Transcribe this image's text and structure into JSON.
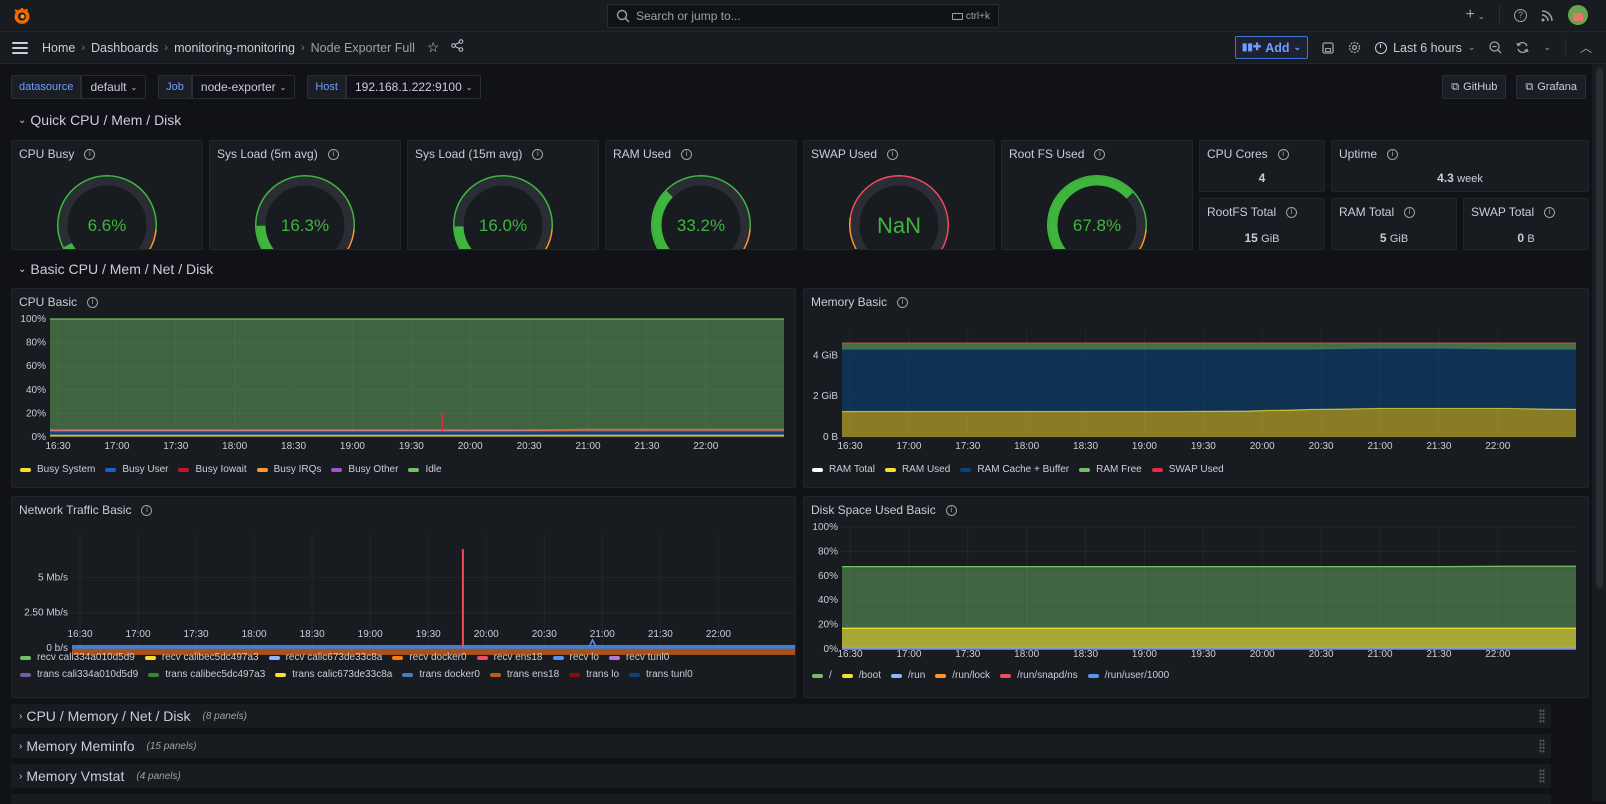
{
  "topbar": {
    "search_placeholder": "Search or jump to...",
    "search_shortcut": "ctrl+k",
    "icons": [
      "grafana-logo-icon",
      "plus-icon",
      "help-icon",
      "news-icon",
      "user-avatar"
    ]
  },
  "breadcrumb": {
    "items": [
      "Home",
      "Dashboards",
      "monitoring-monitoring",
      "Node Exporter Full"
    ]
  },
  "toolbar": {
    "add_label": "Add",
    "time_range": "Last 6 hours"
  },
  "variables": [
    {
      "label": "datasource",
      "value": "default"
    },
    {
      "label": "Job",
      "value": "node-exporter"
    },
    {
      "label": "Host",
      "value": "192.168.1.222:9100"
    }
  ],
  "links": [
    {
      "label": "GitHub"
    },
    {
      "label": "Grafana"
    }
  ],
  "rows": {
    "quick": "Quick CPU / Mem / Disk",
    "basic": "Basic CPU / Mem / Net / Disk",
    "collapsed": [
      {
        "title": "CPU / Memory / Net / Disk",
        "count": "(8 panels)"
      },
      {
        "title": "Memory Meminfo",
        "count": "(15 panels)"
      },
      {
        "title": "Memory Vmstat",
        "count": "(4 panels)"
      }
    ]
  },
  "gauges": [
    {
      "title": "CPU Busy",
      "value_text": "6.6%",
      "value": 6.6
    },
    {
      "title": "Sys Load (5m avg)",
      "value_text": "16.3%",
      "value": 16.3
    },
    {
      "title": "Sys Load (15m avg)",
      "value_text": "16.0%",
      "value": 16.0
    },
    {
      "title": "RAM Used",
      "value_text": "33.2%",
      "value": 33.2
    },
    {
      "title": "SWAP Used",
      "value_text": "NaN",
      "value": null
    },
    {
      "title": "Root FS Used",
      "value_text": "67.8%",
      "value": 67.8
    }
  ],
  "stats": [
    {
      "title": "CPU Cores",
      "value": "4",
      "unit": ""
    },
    {
      "title": "Uptime",
      "value": "4.3",
      "unit": "week"
    },
    {
      "title": "RootFS Total",
      "value": "15",
      "unit": "GiB"
    },
    {
      "title": "RAM Total",
      "value": "5",
      "unit": "GiB"
    },
    {
      "title": "SWAP Total",
      "value": "0",
      "unit": "B"
    }
  ],
  "colors": {
    "green": "#3eb63e",
    "orange": "#ff9830",
    "red": "#f2495c",
    "accent": "#6e9fff"
  },
  "chart_data": [
    {
      "type": "area",
      "title": "CPU Basic",
      "x": [
        "16:30",
        "17:00",
        "17:30",
        "18:00",
        "18:30",
        "19:00",
        "19:30",
        "20:00",
        "20:30",
        "21:00",
        "21:30",
        "22:00"
      ],
      "yticks": [
        "0%",
        "20%",
        "40%",
        "60%",
        "80%",
        "100%"
      ],
      "ylim": [
        0,
        100
      ],
      "stacked": true,
      "series": [
        {
          "name": "Busy System",
          "color": "#fade2a",
          "values": [
            1.5,
            1.5,
            1.5,
            1.5,
            1.5,
            1.5,
            1.5,
            1.5,
            1.5,
            1.5,
            1.5,
            1.5
          ]
        },
        {
          "name": "Busy User",
          "color": "#1f60c4",
          "values": [
            3,
            3,
            3,
            3,
            3,
            3,
            3,
            3,
            3.5,
            3.5,
            3.5,
            3.5
          ]
        },
        {
          "name": "Busy Iowait",
          "color": "#c4162a",
          "values": [
            1,
            1,
            1,
            1,
            1,
            1,
            1,
            1,
            1,
            1,
            1,
            1
          ]
        },
        {
          "name": "Busy IRQs",
          "color": "#ff9830",
          "values": [
            0,
            0,
            0,
            0,
            0,
            0,
            0,
            0,
            0,
            0,
            0,
            0
          ]
        },
        {
          "name": "Busy Other",
          "color": "#a352cc",
          "values": [
            0.5,
            0.5,
            0.5,
            0.5,
            0.5,
            0.5,
            0.5,
            0.5,
            0.5,
            0.5,
            0.5,
            0.5
          ]
        },
        {
          "name": "Idle",
          "color": "#73bf69",
          "values": [
            94,
            94,
            94,
            94,
            94,
            94,
            94,
            94,
            93.5,
            93.5,
            93.5,
            93.5
          ]
        }
      ],
      "annotations": [
        "spike ~20% near 19:30"
      ]
    },
    {
      "type": "area",
      "title": "Memory Basic",
      "x": [
        "16:30",
        "17:00",
        "17:30",
        "18:00",
        "18:30",
        "19:00",
        "19:30",
        "20:00",
        "20:30",
        "21:00",
        "21:30",
        "22:00"
      ],
      "yticks": [
        "0 B",
        "2 GiB",
        "4 GiB"
      ],
      "ylim": [
        0,
        5.2
      ],
      "unit": "GiB",
      "series": [
        {
          "name": "RAM Total",
          "color": "#ffffff",
          "values": [
            4.6,
            4.6,
            4.6,
            4.6,
            4.6,
            4.6,
            4.6,
            4.6,
            4.6,
            4.6,
            4.6,
            4.6
          ]
        },
        {
          "name": "RAM Used",
          "color": "#fade2a",
          "values": [
            1.25,
            1.25,
            1.25,
            1.25,
            1.25,
            1.25,
            1.27,
            1.35,
            1.4,
            1.4,
            1.4,
            1.35
          ]
        },
        {
          "name": "RAM Cache + Buffer",
          "color": "#0a437c",
          "values": [
            3.05,
            3.05,
            3.05,
            3.05,
            3.05,
            3.05,
            3.03,
            2.95,
            2.95,
            2.95,
            2.9,
            2.95
          ]
        },
        {
          "name": "RAM Free",
          "color": "#73bf69",
          "values": [
            0.3,
            0.3,
            0.3,
            0.3,
            0.3,
            0.3,
            0.3,
            0.3,
            0.25,
            0.25,
            0.3,
            0.3
          ]
        },
        {
          "name": "SWAP Used",
          "color": "#e02f44",
          "values": [
            0,
            0,
            0,
            0,
            0,
            0,
            0,
            0,
            0,
            0,
            0,
            0
          ]
        }
      ]
    },
    {
      "type": "line",
      "title": "Network Traffic Basic",
      "x": [
        "16:30",
        "17:00",
        "17:30",
        "18:00",
        "18:30",
        "19:00",
        "19:30",
        "20:00",
        "20:30",
        "21:00",
        "21:30",
        "22:00"
      ],
      "yticks": [
        "0 b/s",
        "2.50 Mb/s",
        "5 Mb/s"
      ],
      "ylim": [
        -0.5,
        8
      ],
      "unit": "Mb/s",
      "series": [
        {
          "name": "recv cali334a010d5d9",
          "color": "#73bf69"
        },
        {
          "name": "recv calibec5dc497a3",
          "color": "#fade2a"
        },
        {
          "name": "recv calic673de33c8a",
          "color": "#8ab8ff"
        },
        {
          "name": "recv docker0",
          "color": "#ff780a"
        },
        {
          "name": "recv ens18",
          "color": "#f2495c"
        },
        {
          "name": "recv lo",
          "color": "#5794f2"
        },
        {
          "name": "recv tunl0",
          "color": "#b877d9"
        },
        {
          "name": "trans cali334a010d5d9",
          "color": "#705da0"
        },
        {
          "name": "trans calibec5dc497a3",
          "color": "#37872d"
        },
        {
          "name": "trans calic673de33c8a",
          "color": "#fade2a"
        },
        {
          "name": "trans docker0",
          "color": "#447ebc"
        },
        {
          "name": "trans ens18",
          "color": "#c15c17"
        },
        {
          "name": "trans lo",
          "color": "#890f02"
        },
        {
          "name": "trans tunl0",
          "color": "#0a437c"
        }
      ],
      "annotations": [
        "recv ens18 spike ~7 Mb/s near 19:30"
      ]
    },
    {
      "type": "area",
      "title": "Disk Space Used Basic",
      "x": [
        "16:30",
        "17:00",
        "17:30",
        "18:00",
        "18:30",
        "19:00",
        "19:30",
        "20:00",
        "20:30",
        "21:00",
        "21:30",
        "22:00"
      ],
      "yticks": [
        "0%",
        "20%",
        "40%",
        "60%",
        "80%",
        "100%"
      ],
      "ylim": [
        0,
        100
      ],
      "series": [
        {
          "name": "/",
          "color": "#73bf69",
          "values": [
            67.5,
            67.5,
            67.5,
            67.5,
            67.5,
            67.5,
            67.5,
            67.5,
            67.5,
            67.5,
            67.8,
            67.8
          ]
        },
        {
          "name": "/boot",
          "color": "#fade2a",
          "values": [
            17,
            17,
            17,
            17,
            17,
            17,
            17,
            17,
            17,
            17,
            17,
            17
          ]
        },
        {
          "name": "/run",
          "color": "#8ab8ff",
          "values": [
            0.5,
            0.5,
            0.5,
            0.5,
            0.5,
            0.5,
            0.5,
            0.5,
            0.5,
            0.5,
            0.5,
            0.5
          ]
        },
        {
          "name": "/run/lock",
          "color": "#ff9830",
          "values": [
            0,
            0,
            0,
            0,
            0,
            0,
            0,
            0,
            0,
            0,
            0,
            0
          ]
        },
        {
          "name": "/run/snapd/ns",
          "color": "#f2495c",
          "values": [
            0,
            0,
            0,
            0,
            0,
            0,
            0,
            0,
            0,
            0,
            0,
            0
          ]
        },
        {
          "name": "/run/user/1000",
          "color": "#5794f2",
          "values": [
            0,
            0,
            0,
            0,
            0,
            0,
            0,
            0,
            0,
            0,
            0,
            0
          ]
        }
      ]
    }
  ]
}
